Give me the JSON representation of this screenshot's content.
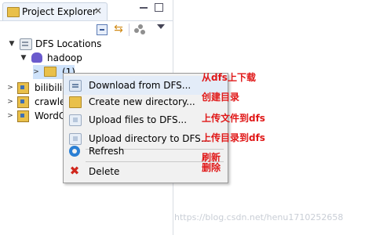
{
  "view": {
    "tab_title": "Project Explorer",
    "close_glyph": "✕"
  },
  "tree": {
    "dfs_locations": "DFS Locations",
    "hadoop": "hadoop",
    "folder": "(1)",
    "projects": [
      "bilibili-",
      "crawle",
      "WordC"
    ]
  },
  "context_menu": {
    "items": [
      "Download from DFS...",
      "Create new directory...",
      "Upload files to DFS...",
      "Upload directory to DFS...",
      "Refresh",
      "Delete"
    ]
  },
  "annotations": {
    "download": "从dfs上下载",
    "create_dir": "创建目录",
    "upload_files": "上传文件到dfs",
    "upload_dir": "上传目录到dfs",
    "refresh": "刷新",
    "delete": "删除"
  },
  "watermark": "https://blog.csdn.net/henu1710252658",
  "icons": {
    "view_tab": "folder-icon",
    "collapse_all": "collapse-all-icon",
    "link_editor": "link-with-editor-icon",
    "view_menu": "chevron-down-icon",
    "dfs": "dfs-location-icon",
    "hadoop": "elephant-icon",
    "refresh": "refresh-icon",
    "delete": "delete-x-icon"
  },
  "colors": {
    "annotation": "#e01818",
    "selection": "#cfe3fb",
    "menu_background": "#f1f1f1"
  }
}
